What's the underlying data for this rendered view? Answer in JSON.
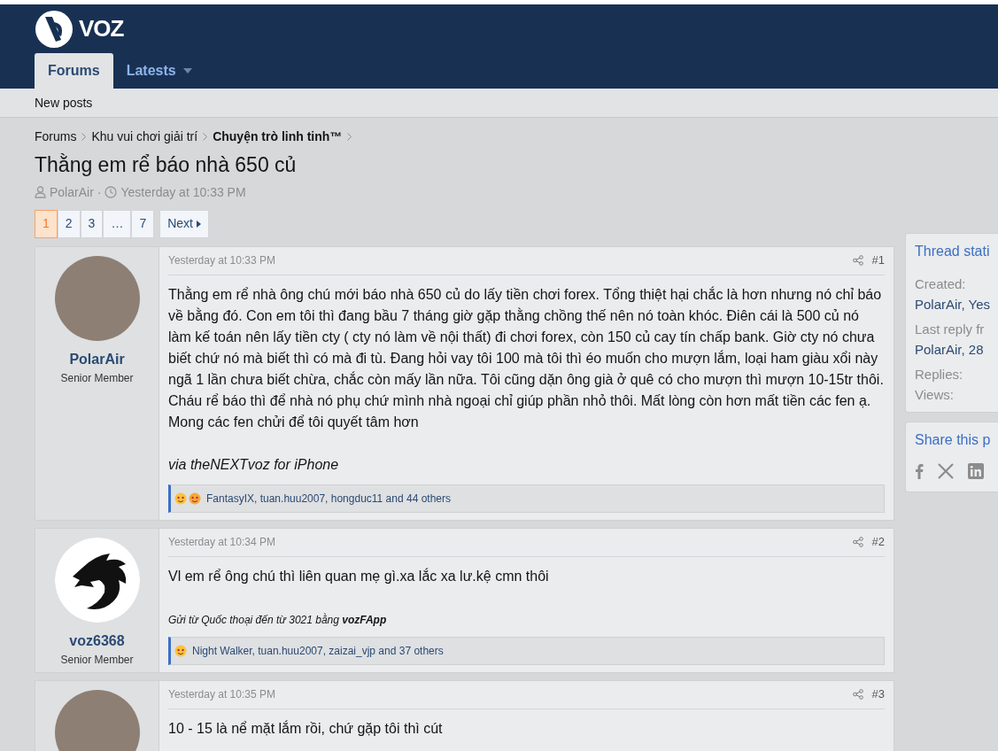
{
  "header": {
    "logo_text": "VOZ"
  },
  "nav_tabs": [
    {
      "label": "Forums",
      "selected": true,
      "dropdown": false
    },
    {
      "label": "Latests",
      "selected": false,
      "dropdown": true
    }
  ],
  "subnav": [
    "New posts"
  ],
  "breadcrumbs": [
    {
      "label": "Forums",
      "current": false
    },
    {
      "label": "Khu vui chơi giải trí",
      "current": false
    },
    {
      "label": "Chuyện trò linh tinh™",
      "current": true
    }
  ],
  "thread": {
    "title": "Thằng em rể báo nhà 650 củ",
    "author": "PolarAir",
    "separator": "·",
    "date": "Yesterday at 10:33 PM"
  },
  "pagination": {
    "pages": [
      {
        "label": "1",
        "selected": true
      },
      {
        "label": "2",
        "selected": false
      },
      {
        "label": "3",
        "selected": false
      },
      {
        "label": "…",
        "selected": false
      },
      {
        "label": "7",
        "selected": false
      }
    ],
    "next": "Next"
  },
  "posts": [
    {
      "author": "PolarAir",
      "role": "Senior Member",
      "kind": "photo",
      "date": "Yesterday at 10:33 PM",
      "number": "#1",
      "body": "Thằng em rể nhà ông chú mới báo nhà 650 củ do lấy tiền chơi forex. Tổng thiệt hại chắc là hơn nhưng nó chỉ báo về bằng đó. Con em tôi thì đang bầu 7 tháng giờ gặp thằng chồng thế nên nó toàn khóc. Điên cái là 500 củ nó làm kế toán nên lấy tiền cty ( cty nó làm về nội thất) đi chơi forex, còn 150 củ cay tín chấp bank. Giờ cty nó chưa biết chứ nó mà biết thì có mà đi tù. Đang hỏi vay tôi 100 mà tôi thì éo muốn cho mượn lắm, loại ham giàu xổi này ngã 1 lần chưa biết chừa, chắc còn mấy lần nữa. Tôi cũng dặn ông già ở quê có cho mượn thì mượn 10-15tr thôi. Cháu rể báo thì để nhà nó phụ chứ mình nhà ngoại chỉ giúp phần nhỏ thôi. Mất lòng còn hơn mất tiền các fen ạ. Mong các fen chửi để tôi quyết tâm hơn",
      "signature": {
        "kind": "link",
        "before": "via ",
        "link": "theNEXTvoz",
        "after": " for iPhone"
      },
      "reactions": {
        "icons": [
          {
            "kind": "love"
          },
          {
            "kind": "heart"
          }
        ],
        "text": "FantasyIX, tuan.huu2007, hongduc11 and 44 others"
      }
    },
    {
      "author": "voz6368",
      "role": "Senior Member",
      "kind": "dragon",
      "date": "Yesterday at 10:34 PM",
      "number": "#2",
      "body": "Vl em rể ông chú thì liên quan mẹ gì.xa lắc xa lư.kệ cmn thôi",
      "signature": {
        "kind": "small",
        "text": "Gửi từ Quốc thoại đến từ 3021 bằng **vozFApp**"
      },
      "reactions": {
        "icons": [
          {
            "kind": "love"
          }
        ],
        "text": "Night Walker, tuan.huu2007, zaizai_vjp and 37 others"
      }
    },
    {
      "kind": "photo",
      "date": "Yesterday at 10:35 PM",
      "number": "#3",
      "body": "10 - 15 là nể mặt lắm rồi, chứ gặp tôi thì cút"
    }
  ],
  "sidebar": {
    "stats_title": "Thread stati",
    "stats": [
      {
        "label": "Created:",
        "value": "PolarAir, Yes"
      },
      {
        "label": "Last reply fr",
        "value": "PolarAir, 28"
      },
      {
        "label": "Replies:"
      },
      {
        "label": "Views:"
      }
    ],
    "share_title": "Share this p"
  }
}
